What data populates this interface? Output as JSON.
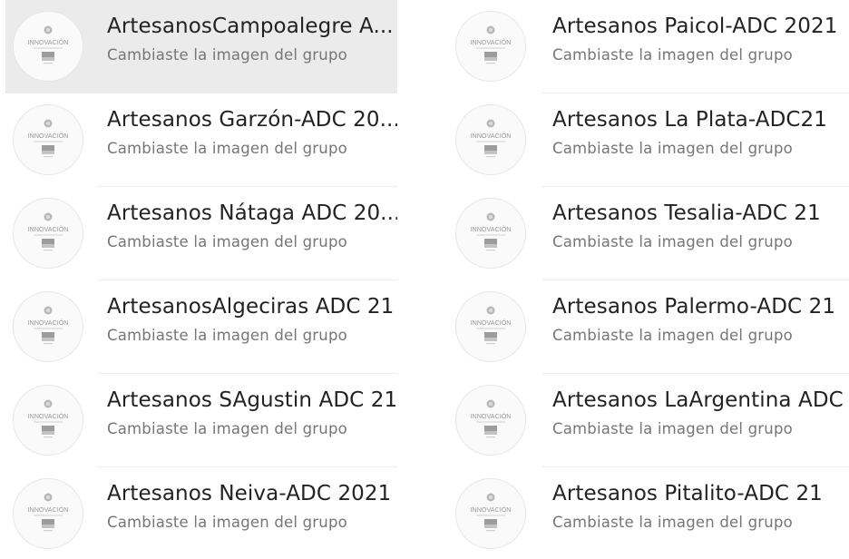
{
  "left_column": {
    "chats": [
      {
        "title": "ArtesanosCampoalegre A...",
        "subtitle": "Cambiaste la imagen del grupo",
        "avatar": "innovacion-group-icon",
        "selected": true
      },
      {
        "title": "Artesanos Garzón-ADC 20...",
        "subtitle": "Cambiaste la imagen del grupo",
        "avatar": "innovacion-group-icon"
      },
      {
        "title": "Artesanos Nátaga ADC 20...",
        "subtitle": "Cambiaste la imagen del grupo",
        "avatar": "innovacion-group-icon"
      },
      {
        "title": "ArtesanosAlgeciras ADC 21",
        "subtitle": "Cambiaste la imagen del grupo",
        "avatar": "innovacion-group-icon"
      },
      {
        "title": "Artesanos SAgustin ADC 21",
        "subtitle": "Cambiaste la imagen del grupo",
        "avatar": "innovacion-group-icon"
      },
      {
        "title": "Artesanos Neiva-ADC 2021",
        "subtitle": "Cambiaste la imagen del grupo",
        "avatar": "innovacion-group-icon"
      }
    ]
  },
  "right_column": {
    "chats": [
      {
        "title": "Artesanos Paicol-ADC 2021",
        "subtitle": "Cambiaste la imagen del grupo",
        "avatar": "innovacion-group-icon"
      },
      {
        "title": "Artesanos La Plata-ADC21",
        "subtitle": "Cambiaste la imagen del grupo",
        "avatar": "innovacion-group-icon"
      },
      {
        "title": "Artesanos Tesalia-ADC 21",
        "subtitle": "Cambiaste la imagen del grupo",
        "avatar": "innovacion-group-icon"
      },
      {
        "title": "Artesanos Palermo-ADC 21",
        "subtitle": "Cambiaste la imagen del grupo",
        "avatar": "innovacion-group-icon"
      },
      {
        "title": "Artesanos LaArgentina ADC",
        "subtitle": "Cambiaste la imagen del grupo",
        "avatar": "innovacion-group-icon"
      },
      {
        "title": "Artesanos Pitalito-ADC 21",
        "subtitle": "Cambiaste la imagen del grupo",
        "avatar": "innovacion-group-icon"
      }
    ]
  },
  "avatar_logo": {
    "text": "INNOVACIÓN"
  },
  "colors": {
    "selected_background": "#ebebeb",
    "title_text": "#222222",
    "subtitle_text": "#767676",
    "divider": "#ececec"
  }
}
